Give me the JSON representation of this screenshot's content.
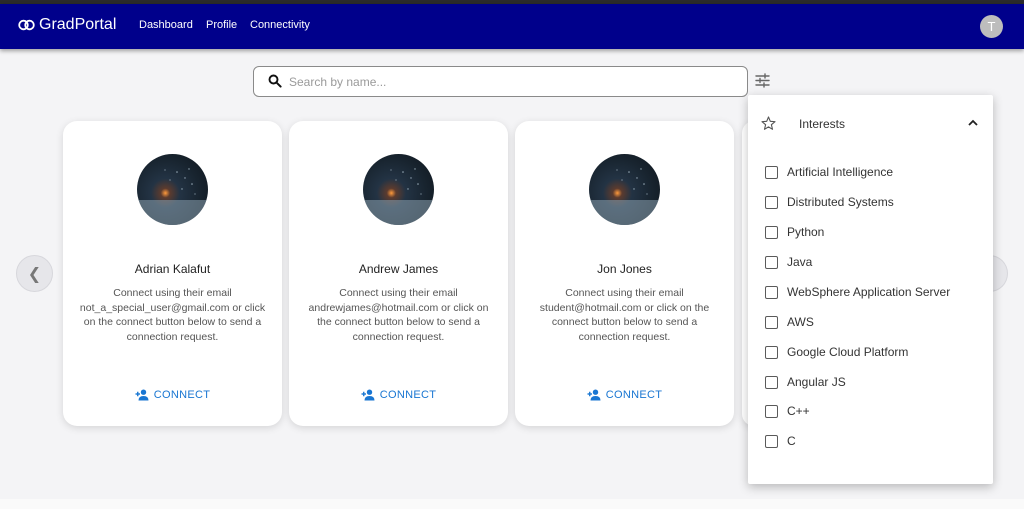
{
  "navbar": {
    "brand": "GradPortal",
    "links": [
      "Dashboard",
      "Profile",
      "Connectivity"
    ],
    "avatar_initial": "T",
    "color": "#00008b"
  },
  "search": {
    "placeholder": "Search by name..."
  },
  "cards": [
    {
      "name": "Adrian Kalafut",
      "description": "Connect using their email not_a_special_user@gmail.com or click on the connect button below to send a connection request.",
      "connect_label": "CONNECT"
    },
    {
      "name": "Andrew James",
      "description": "Connect using their email andrewjames@hotmail.com or click on the connect button below to send a connection request.",
      "connect_label": "CONNECT"
    },
    {
      "name": "Jon Jones",
      "description": "Connect using their email student@hotmail.com or click on the connect button below to send a connection request.",
      "connect_label": "CONNECT"
    }
  ],
  "carousel": {
    "prev_glyph": "❮"
  },
  "filter_panel": {
    "title": "Interests",
    "options": [
      "Artificial Intelligence",
      "Distributed Systems",
      "Python",
      "Java",
      "WebSphere Application Server",
      "AWS",
      "Google Cloud Platform",
      "Angular JS",
      "C++",
      "C"
    ]
  },
  "icons": {
    "search": "search-icon",
    "filter": "tune-icon",
    "star": "star-outline-icon",
    "chevron": "chevron-up-icon",
    "connect": "person-add-icon"
  },
  "colors": {
    "accent": "#1976d2",
    "navbar": "#00008b"
  }
}
